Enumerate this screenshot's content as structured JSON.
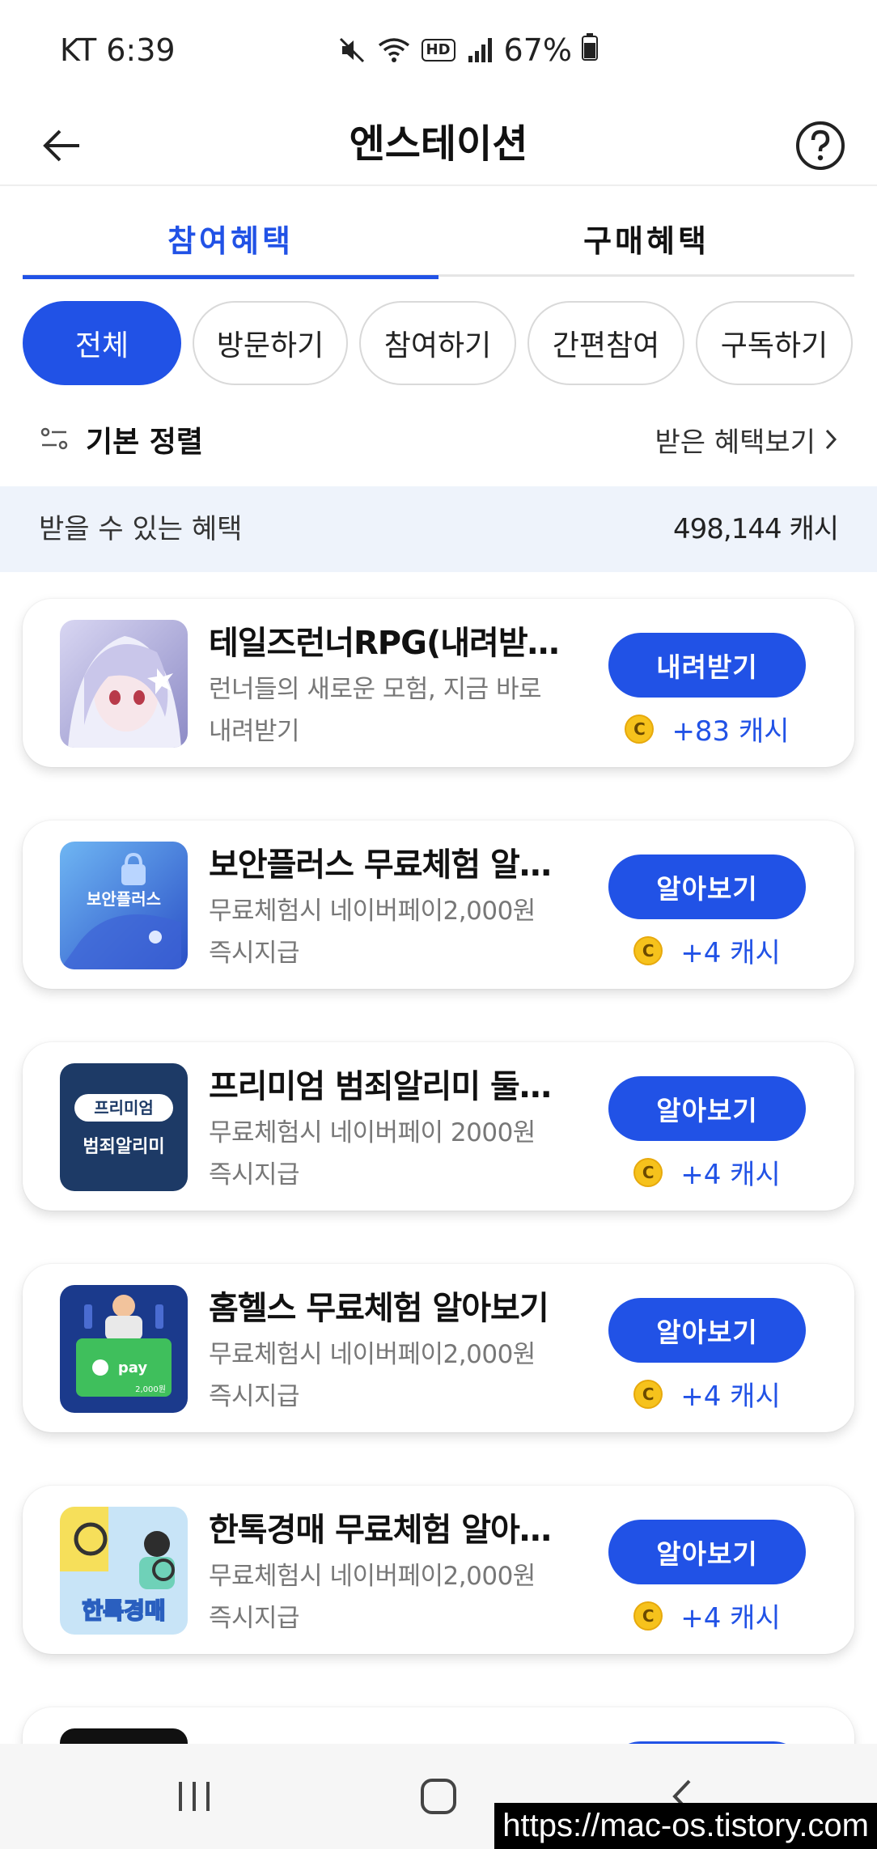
{
  "status": {
    "carrier_time": "KT 6:39",
    "battery": "67%",
    "hd_label": "HD"
  },
  "appbar": {
    "title": "엔스테이션"
  },
  "tabs": [
    {
      "label": "참여혜택",
      "active": true
    },
    {
      "label": "구매혜택",
      "active": false
    }
  ],
  "chips": [
    {
      "label": "전체",
      "active": true
    },
    {
      "label": "방문하기",
      "active": false
    },
    {
      "label": "참여하기",
      "active": false
    },
    {
      "label": "간편참여",
      "active": false
    },
    {
      "label": "구독하기",
      "active": false
    }
  ],
  "sort": {
    "label": "기본 정렬",
    "view_label": "받은 혜택보기"
  },
  "benefit": {
    "label": "받을 수 있는 혜택",
    "amount": "498,144 캐시"
  },
  "items": [
    {
      "title": "테일즈런너RPG(내려받기)",
      "desc": "런너들의 새로운 모험, 지금 바로 내려받기",
      "button": "내려받기",
      "coin": "C",
      "reward": "+83 캐시"
    },
    {
      "title": "보안플러스 무료체험 알아보기",
      "desc": "무료체험시 네이버페이2,000원 즉시지급",
      "button": "알아보기",
      "coin": "C",
      "reward": "+4 캐시",
      "thumb_text": "보안플러스"
    },
    {
      "title": "프리미엄 범죄알리미 둘러보기",
      "desc": "무료체험시 네이버페이 2000원 즉시지급",
      "button": "알아보기",
      "coin": "C",
      "reward": "+4 캐시",
      "thumb_text": "프리미엄",
      "thumb_text2": "범죄알리미"
    },
    {
      "title": "홈헬스 무료체험 알아보기",
      "desc": "무료체험시 네이버페이2,000원 즉시지급",
      "button": "알아보기",
      "coin": "C",
      "reward": "+4 캐시",
      "thumb_text": "pay",
      "thumb_text2": "2,000원"
    },
    {
      "title": "한톡경매 무료체험 알아보기",
      "desc": "무료체험시 네이버페이2,000원 즉시지급",
      "button": "알아보기",
      "coin": "C",
      "reward": "+4 캐시",
      "thumb_text": "한톡경매"
    }
  ],
  "watermark": "https://mac-os.tistory.com",
  "colors": {
    "accent": "#2152e6",
    "benefit_bg": "#eef3fb",
    "coin": "#f6c21c"
  }
}
